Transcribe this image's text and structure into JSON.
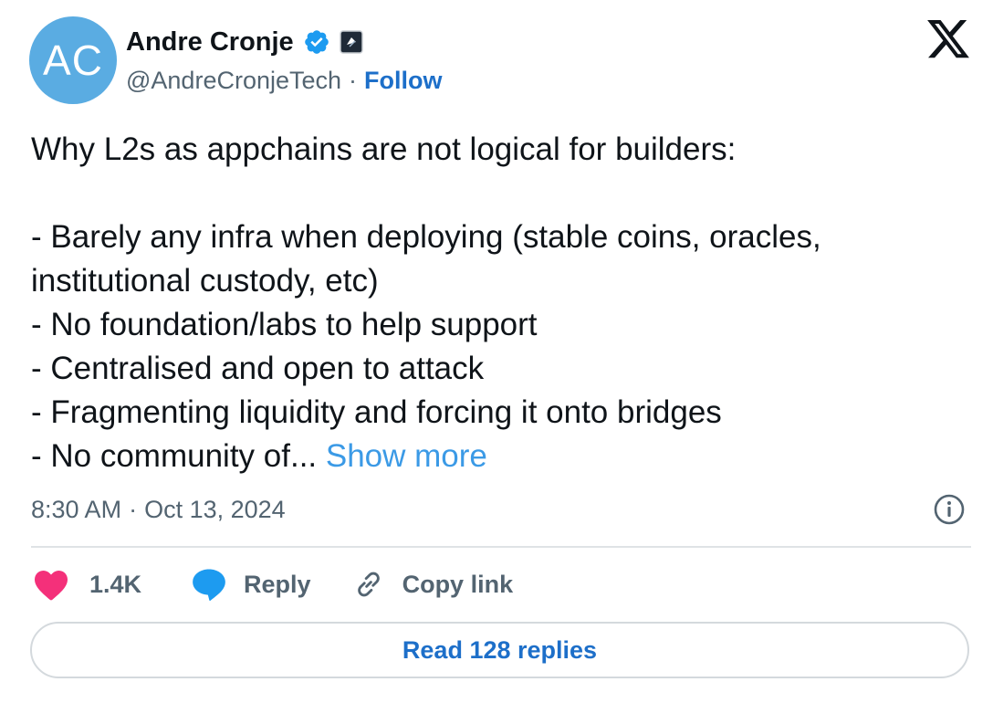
{
  "author": {
    "avatar_initials": "AC",
    "avatar_color": "#5aace2",
    "display_name": "Andre Cronje",
    "handle": "@AndreCronjeTech",
    "separator": "·",
    "follow_label": "Follow",
    "verified_icon": "verified-badge-icon",
    "affiliate_icon": "affiliate-badge-icon"
  },
  "platform_icon": "x-logo-icon",
  "tweet": {
    "lines": [
      "Why L2s as appchains are not logical for builders:",
      "",
      "- Barely any infra when deploying (stable coins, oracles,",
      "institutional custody, etc)",
      "- No foundation/labs to help support",
      "- Centralised and open to attack",
      "- Fragmenting liquidity and forcing it onto bridges"
    ],
    "last_line": "- No community of...",
    "show_more_label": "Show more"
  },
  "timestamp": {
    "time": "8:30 AM",
    "separator": "·",
    "date": "Oct 13, 2024"
  },
  "actions": {
    "like_count": "1.4K",
    "reply_label": "Reply",
    "copy_link_label": "Copy link"
  },
  "read_replies_label": "Read 128 replies",
  "colors": {
    "link_blue": "#1d6fc9",
    "show_more_blue": "#3b9ae6",
    "like_pink": "#f4307a",
    "reply_blue": "#1d9bf0",
    "muted_gray": "#536471"
  }
}
